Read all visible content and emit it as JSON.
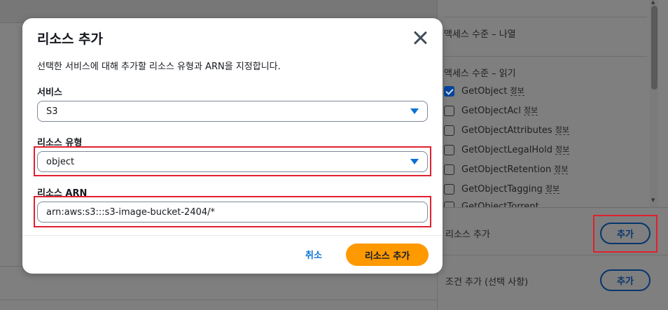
{
  "modal": {
    "title": "리소스 추가",
    "description": "선택한 서비스에 대해 추가할 리소스 유형과 ARN을 지정합니다.",
    "service": {
      "label": "서비스",
      "value": "S3"
    },
    "resource_type": {
      "label": "리소스 유형",
      "value": "object"
    },
    "resource_arn": {
      "label": "리소스 ARN",
      "value": "arn:aws:s3:::s3-image-bucket-2404/*"
    },
    "cancel_label": "취소",
    "add_resource_label": "리소스 추가"
  },
  "side_panel": {
    "list_access_heading": "액세스 수준 – 나열",
    "read_access_heading": "액세스 수준 – 읽기",
    "info_label": "정보",
    "permissions": [
      {
        "name": "GetObject",
        "checked": true
      },
      {
        "name": "GetObjectAcl",
        "checked": false
      },
      {
        "name": "GetObjectAttributes",
        "checked": false
      },
      {
        "name": "GetObjectLegalHold",
        "checked": false
      },
      {
        "name": "GetObjectRetention",
        "checked": false
      },
      {
        "name": "GetObjectTagging",
        "checked": false
      },
      {
        "name": "GetObjectTorrent",
        "checked": false
      }
    ],
    "add_resource_heading": "리소스 추가",
    "add_resource_button": "추가",
    "add_condition_heading": "조건 추가 (선택 사항)",
    "add_condition_button": "추가"
  }
}
